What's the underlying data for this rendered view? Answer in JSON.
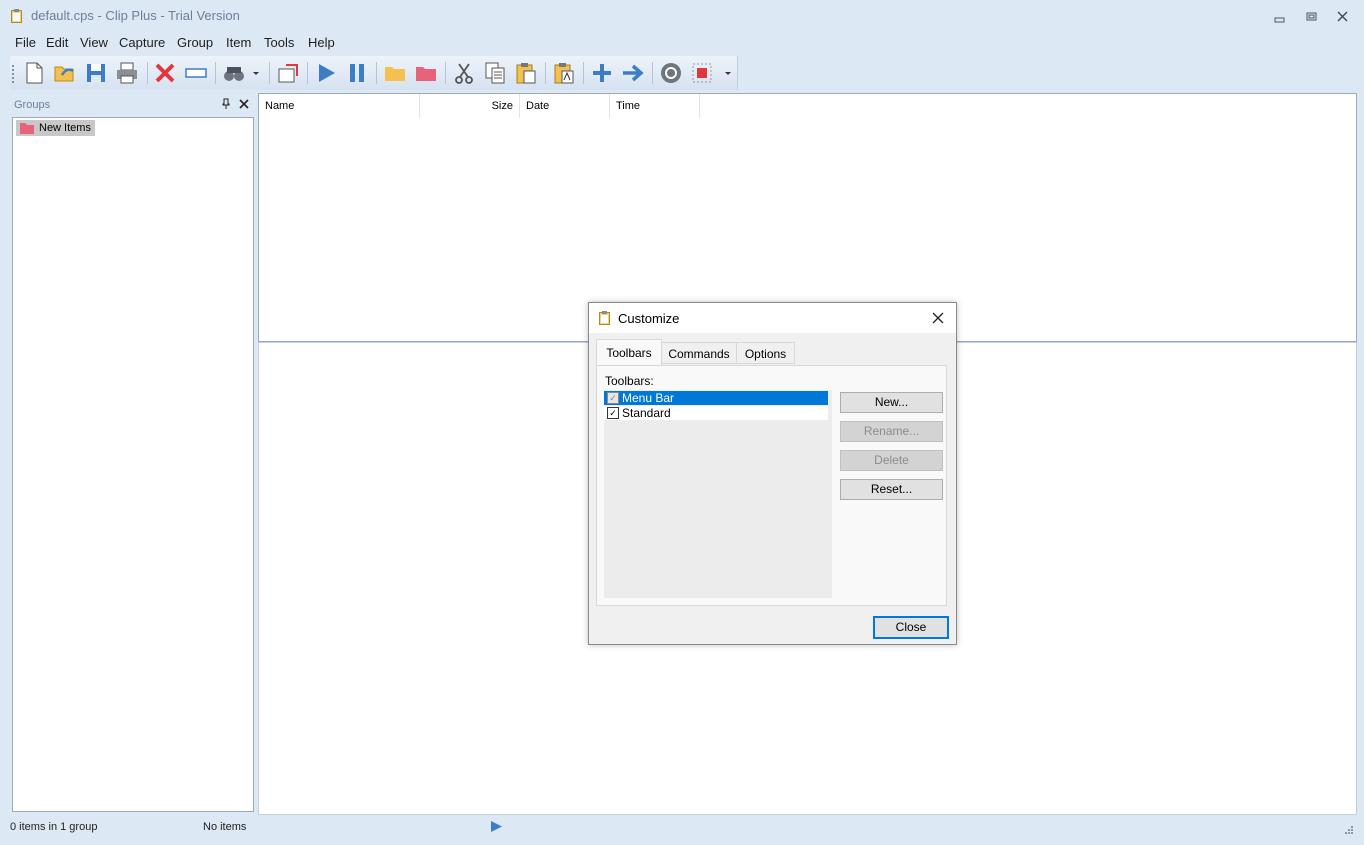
{
  "window": {
    "title": "default.cps - Clip Plus - Trial Version"
  },
  "menu": [
    {
      "label": "File"
    },
    {
      "label": "Edit"
    },
    {
      "label": "View"
    },
    {
      "label": "Capture"
    },
    {
      "label": "Group"
    },
    {
      "label": "Item"
    },
    {
      "label": "Tools"
    },
    {
      "label": "Help"
    }
  ],
  "toolbar": {
    "icons": [
      "new-icon",
      "open-icon",
      "save-icon",
      "print-icon",
      "delete-icon",
      "rename-icon",
      "find-icon",
      "properties-icon",
      "play-icon",
      "pause-icon",
      "open-folder-icon",
      "group-folder-icon",
      "cut-icon",
      "copy-icon",
      "paste-icon",
      "paste-special-icon",
      "add-icon",
      "forward-icon",
      "capture-icon",
      "stop-capture-icon",
      "overflow-icon"
    ]
  },
  "groups_panel": {
    "title": "Groups",
    "items": [
      {
        "label": "New Items"
      }
    ]
  },
  "list": {
    "columns": [
      "Name",
      "Size",
      "Date",
      "Time"
    ]
  },
  "status": {
    "count": "0 items in 1 group",
    "selection": "No items"
  },
  "dialog": {
    "title": "Customize",
    "tabs": [
      "Toolbars",
      "Commands",
      "Options"
    ],
    "active_tab": "Toolbars",
    "list_label": "Toolbars:",
    "toolbars": [
      {
        "label": "Menu Bar",
        "checked": true,
        "selected": true
      },
      {
        "label": "Standard",
        "checked": true,
        "selected": false
      }
    ],
    "buttons": {
      "new": "New...",
      "rename": "Rename...",
      "delete": "Delete",
      "reset": "Reset...",
      "close": "Close"
    }
  },
  "colors": {
    "chrome": "#dde8f5",
    "selection": "#0078d7",
    "accent_blue": "#3b7ec6",
    "delete_red": "#e0383e"
  }
}
